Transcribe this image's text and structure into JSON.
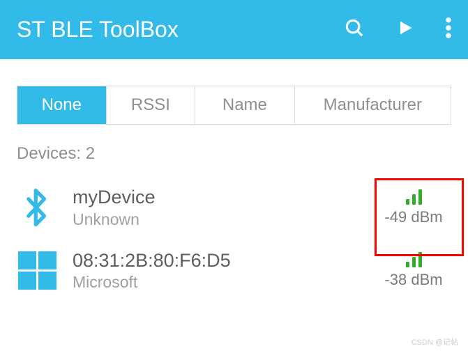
{
  "header": {
    "title": "ST BLE ToolBox"
  },
  "filters": {
    "tabs": [
      "None",
      "RSSI",
      "Name",
      "Manufacturer"
    ],
    "active": 0
  },
  "devices_label": "Devices: 2",
  "devices": [
    {
      "name": "myDevice",
      "vendor": "Unknown",
      "rssi": "-49 dBm",
      "signal_level": 3,
      "icon": "bluetooth"
    },
    {
      "name": "08:31:2B:80:F6:D5",
      "vendor": "Microsoft",
      "rssi": "-38 dBm",
      "signal_level": 3,
      "icon": "windows"
    }
  ],
  "watermark": "CSDN @记帖"
}
